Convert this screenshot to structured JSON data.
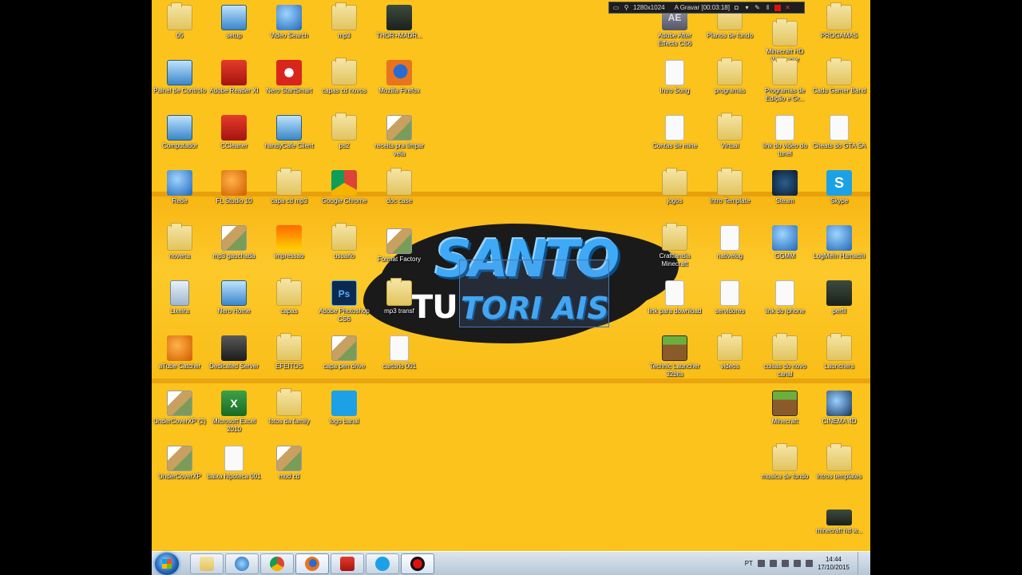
{
  "recorder": {
    "resolution": "1280x1024",
    "status": "A Gravar [00:03:18]"
  },
  "logo": {
    "line1": "SANTO",
    "line2_prefix": "TU",
    "line2_rest": "TORI AIS"
  },
  "icons": {
    "i05": "05",
    "setup": "setup",
    "video_search": "Video Search",
    "mp3": "mp3",
    "thor": "THOR+MADR...",
    "painel": "Painel de Controlo",
    "adobe_reader": "Adobe Reader XI",
    "nero_startsmart": "Nero StartSmart",
    "capas_cd_novos": "capas cd novos",
    "firefox": "Mozilla Firefox",
    "computador": "Computador",
    "ccleaner": "CCleaner",
    "handycafe": "handyCafe Client",
    "ps2": "ps2",
    "receita": "receita pra limpar vela",
    "rede": "Rede",
    "fl_studio": "FL Studio 10",
    "capa_cd_mp3": "capa cd mp3",
    "chrome": "Google Chrome",
    "doc_case": "doc case",
    "novena": "novena",
    "mp3_gauchada": "mp3 gauchada",
    "impressao": "impressao",
    "usuario": "usuario",
    "format_factory": "Format Factory",
    "lixeira": "Lixeira",
    "nero_home": "Nero Home",
    "capas": "capas",
    "photoshop": "Adobe Photoshop CS6",
    "mp3_transf": "mp3 transf",
    "atube": "aTube Catcher",
    "dedicated_server": "Dedicated Server",
    "efeitos": "EFEITOS",
    "capa_pen_drive": "capa pen drive",
    "cartorio": "cartorio 001",
    "undercover2": "UnderCoverXP (2)",
    "excel": "Microsoft Excel 2010",
    "fotos_family": "fotos da family",
    "logo_banal": "logo banal",
    "undercover": "UnderCoverXP",
    "baixa_hipoteca": "baixa hipoteca 001",
    "mod_cd": "mod cd",
    "after_effects": "Adobe After Effects CS6",
    "planos_fundo": "Planos de fundo",
    "minecraft_hd": "Minecraft HD Wallpaper",
    "progamas": "PROGAMAS",
    "intro_song": "Intro Song",
    "programas": "programas",
    "programas_edicao": "Programas de Edição e Gr...",
    "cadu_gamer": "Cadu Gamer Band",
    "contas_mine": "Contas de mine",
    "virtual": "Virtual",
    "link_video": "link do video do tunel",
    "cheats_gta": "Cheats do GTA SA",
    "jogos": "jogos",
    "intro_template": "Intro Template",
    "steam": "Steam",
    "skype": "Skype",
    "craftlandia": "Craftlandia Minecraft",
    "nativelog": "nativelog",
    "ggmm": "GGMM",
    "hamachi": "LogMeIn Hamachi",
    "link_download": "link para download",
    "servidores": "servidores",
    "link_iphone": "link do iphone",
    "perfil": "perfil",
    "technic": "Technic Launcher 32bits",
    "videos": "videos",
    "coisas_canal": "coisas do novo canal",
    "launchers": "Launchers",
    "minecraft": "Minecraft",
    "cinema4d": "CINEMA 4D",
    "musica_fundo": "musica de fundo",
    "intros_templates": "intros templates",
    "minecraft_hd_w": "minecraft hd w..."
  },
  "taskbar": {
    "language": "PT",
    "time": "14:44",
    "date": "17/10/2015"
  }
}
